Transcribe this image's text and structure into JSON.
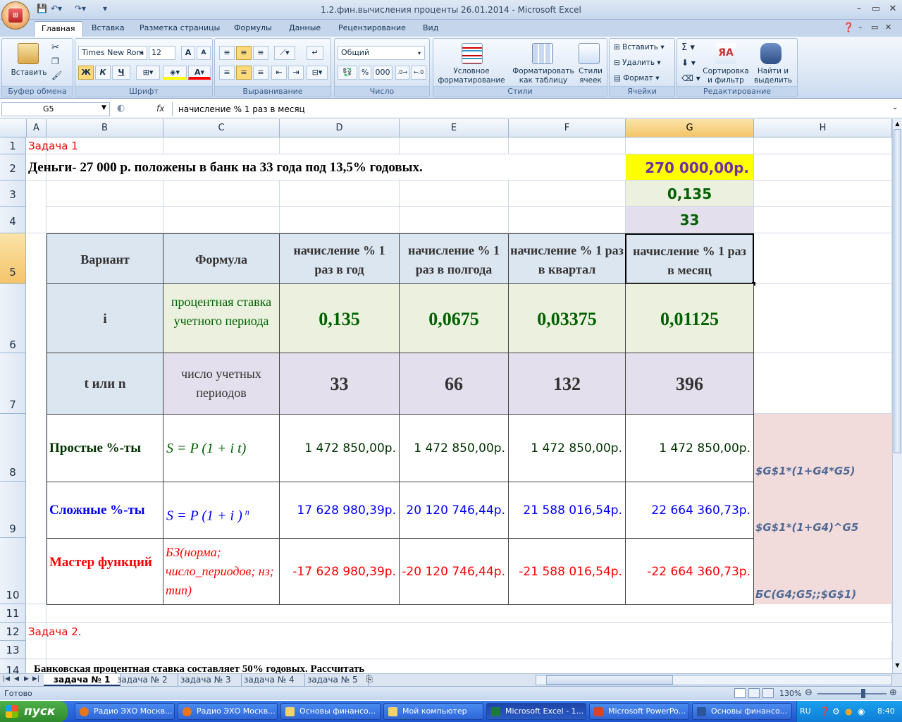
{
  "window": {
    "title": "1.2.фин.вычисления проценты 26.01.2014  -  Microsoft Excel",
    "office_button": "Office"
  },
  "ribbon": {
    "tabs": [
      "Главная",
      "Вставка",
      "Разметка страницы",
      "Формулы",
      "Данные",
      "Рецензирование",
      "Вид"
    ],
    "active_tab": "Главная",
    "clipboard": {
      "paste": "Вставить",
      "label": "Буфер обмена"
    },
    "font": {
      "name": "Times New Rom",
      "size": "12",
      "bold": "Ж",
      "italic": "К",
      "underline": "Ч",
      "label": "Шрифт"
    },
    "alignment": {
      "label": "Выравнивание"
    },
    "number": {
      "format": "Общий",
      "label": "Число",
      "thousands": "000"
    },
    "styles": {
      "conditional": "Условное форматирование",
      "as_table": "Форматировать как таблицу",
      "cell_styles": "Стили ячеек",
      "label": "Стили"
    },
    "cells": {
      "insert": "Вставить",
      "delete": "Удалить",
      "format": "Формат",
      "label": "Ячейки"
    },
    "editing": {
      "sort": "Сортировка и фильтр",
      "find": "Найти и выделить",
      "label": "Редактирование"
    }
  },
  "formula_bar": {
    "name_box": "G5",
    "fx": "fx",
    "formula": "начисление % 1 раз в месяц"
  },
  "columns": [
    "A",
    "B",
    "C",
    "D",
    "E",
    "F",
    "G",
    "H"
  ],
  "selected_column": "G",
  "rows": [
    "1",
    "2",
    "3",
    "4",
    "5",
    "6",
    "7",
    "8",
    "9",
    "10",
    "11",
    "12",
    "13",
    "14"
  ],
  "selected_row": "5",
  "sheet": {
    "r1": {
      "label": "Задача 1"
    },
    "r2": {
      "text": "Деньги- 27 000 р. положены в банк на 33 года под 13,5% годовых.",
      "g": "270 000,00р."
    },
    "r3": {
      "g": "0,135"
    },
    "r4": {
      "g": "33"
    },
    "header": {
      "b": "Вариант",
      "c": "Формула",
      "d": "начисление % 1 раз в год",
      "e": "начисление % 1 раз в полгода",
      "f": "начисление % 1 раз в квартал",
      "g": "начисление % 1 раз в месяц"
    },
    "r6": {
      "b": "i",
      "c": "процентная ставка учетного периода",
      "d": "0,135",
      "e": "0,0675",
      "f": "0,03375",
      "g": "0,01125"
    },
    "r7": {
      "b": "t или n",
      "c": "число учетных периодов",
      "d": "33",
      "e": "66",
      "f": "132",
      "g": "396"
    },
    "r8": {
      "b": "Простые %-ты",
      "c": "S = P (1 + i t)",
      "d": "1 472 850,00р.",
      "e": "1 472 850,00р.",
      "f": "1 472 850,00р.",
      "g": "1 472 850,00р.",
      "h": "$G$1*(1+G4*G5)"
    },
    "r9": {
      "b": "Сложные %-ты",
      "c": "S = P (1 + i )",
      "c_sup": "n",
      "d": "17 628 980,39р.",
      "e": "20 120 746,44р.",
      "f": "21 588 016,54р.",
      "g": "22 664 360,73р.",
      "h": "$G$1*(1+G4)^G5"
    },
    "r10": {
      "b": "Мастер функций",
      "c": "БЗ(норма; число_периодов; нз; тип)",
      "d": "-17 628 980,39р.",
      "e": "-20 120 746,44р.",
      "f": "-21 588 016,54р.",
      "g": "-22 664 360,73р.",
      "h": "БС(G4;G5;;$G$1)"
    },
    "r12": {
      "label": "Задача 2."
    },
    "r14": {
      "text": "Банковская процентная ставка составляет 50% годовых. Рассчитать"
    }
  },
  "sheet_tabs": [
    "задача № 1",
    "задача № 2",
    "задача № 3",
    "задача № 4",
    "задача № 5"
  ],
  "active_sheet": "задача № 1",
  "status": {
    "ready": "Готово",
    "zoom": "130%"
  },
  "taskbar": {
    "start": "пуск",
    "items": [
      "Радио ЭХО Москв...",
      "Радио ЭХО Москв...",
      "Основы финансо...",
      "Мой компьютер",
      "Microsoft Excel - 1...",
      "Microsoft PowerPo...",
      "Основы финансо..."
    ],
    "active_index": 4,
    "lang": "RU",
    "clock": "8:40"
  },
  "colors": {
    "yellow": "#ffff00",
    "green_fill": "#ebf1de",
    "purple_fill": "#e4dfec",
    "header_fill": "#dce6f1",
    "pink_fill": "#f2dcdb",
    "red_text": "#ff0000",
    "blue_text": "#0000ff",
    "green_text": "#006100"
  }
}
